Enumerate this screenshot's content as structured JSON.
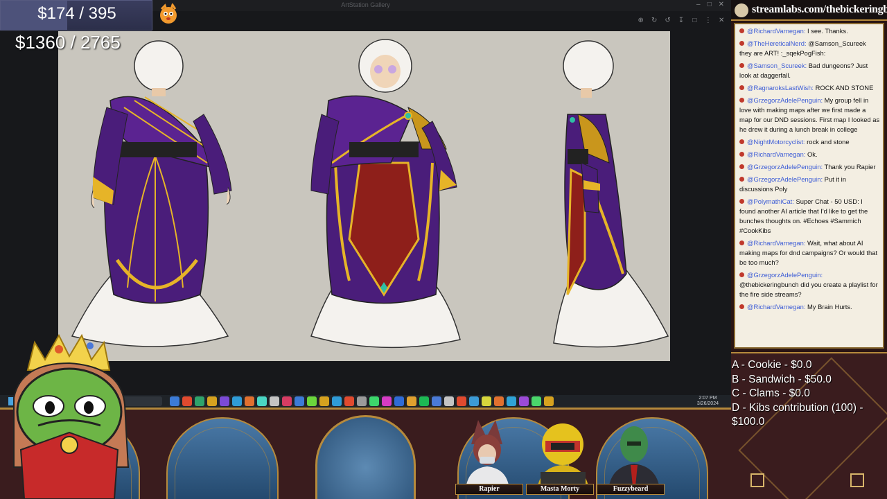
{
  "viewer": {
    "title": "ArtStation Gallery",
    "tools": [
      "zoom-in",
      "zoom-out",
      "rotate",
      "save",
      "fullscreen",
      "menu"
    ]
  },
  "goals": {
    "primary": "$174 / 395",
    "primary_progress": 0.44,
    "secondary": "$1360 / 2765"
  },
  "taskbar": {
    "time": "2:07 PM",
    "date": "3/26/2024"
  },
  "tip_banner": {
    "url": "streamlabs.com/thebickeringbunch/tip"
  },
  "chat": {
    "messages": [
      {
        "user": "@RichardVarnegan:",
        "text": "I see. Thanks."
      },
      {
        "user": "@TheHereticalNerd:",
        "text": "@Samson_Scureek they are ART! :_sqekPogFish:"
      },
      {
        "user": "@Samson_Scureek:",
        "text": "Bad dungeons? Just look at daggerfall."
      },
      {
        "user": "@RagnaroksLastWish:",
        "text": "ROCK AND STONE"
      },
      {
        "user": "@GrzegorzAdelePenguin:",
        "text": "My group fell in love with making maps after we first made a map for our DND sessions. First map I looked as he drew it during a lunch break in college"
      },
      {
        "user": "@NightMotorcyclist:",
        "text": "rock and stone"
      },
      {
        "user": "@RichardVarnegan:",
        "text": "Ok."
      },
      {
        "user": "@GrzegorzAdelePenguin:",
        "text": "Thank you Rapier"
      },
      {
        "user": "@GrzegorzAdelePenguin:",
        "text": "Put it in discussions Poly"
      },
      {
        "user": "@PolymathiCat:",
        "text": "Super Chat - 50 USD: I found another AI article that I'd like to get the bunches thoughts on. #Echoes #Sammich #CookKibs"
      },
      {
        "user": "@RichardVarnegan:",
        "text": "Wait, what about AI making maps for dnd campaigns? Or would that be too much?"
      },
      {
        "user": "@GrzegorzAdelePenguin:",
        "text": "@thebickeringbunch did you create a playlist for the fire side streams?"
      },
      {
        "user": "@RichardVarnegan:",
        "text": "My Brain Hurts."
      }
    ]
  },
  "tip_menu": [
    "A - Cookie - $0.0",
    "B - Sandwich - $50.0",
    "C - Clams - $0.0",
    "D - Kibs contribution (100) - $100.0"
  ],
  "hosts": [
    "Rapier",
    "Masta Morty",
    "Fuzzybeard"
  ],
  "colors": {
    "frame_gold": "#b68a3c",
    "frame_maroon": "#3a1c1e",
    "chat_username": "#3b5bd6",
    "chat_dot": "#c0392b",
    "robe_purple": "#4a1d7a",
    "robe_gold": "#e6b428",
    "robe_red": "#8e1f1a"
  },
  "icons": [
    "search-icon",
    "close-icon",
    "minimize-icon",
    "maximize-icon",
    "fish-emoji-icon",
    "crown-icon",
    "streamlabs-logo-icon"
  ]
}
